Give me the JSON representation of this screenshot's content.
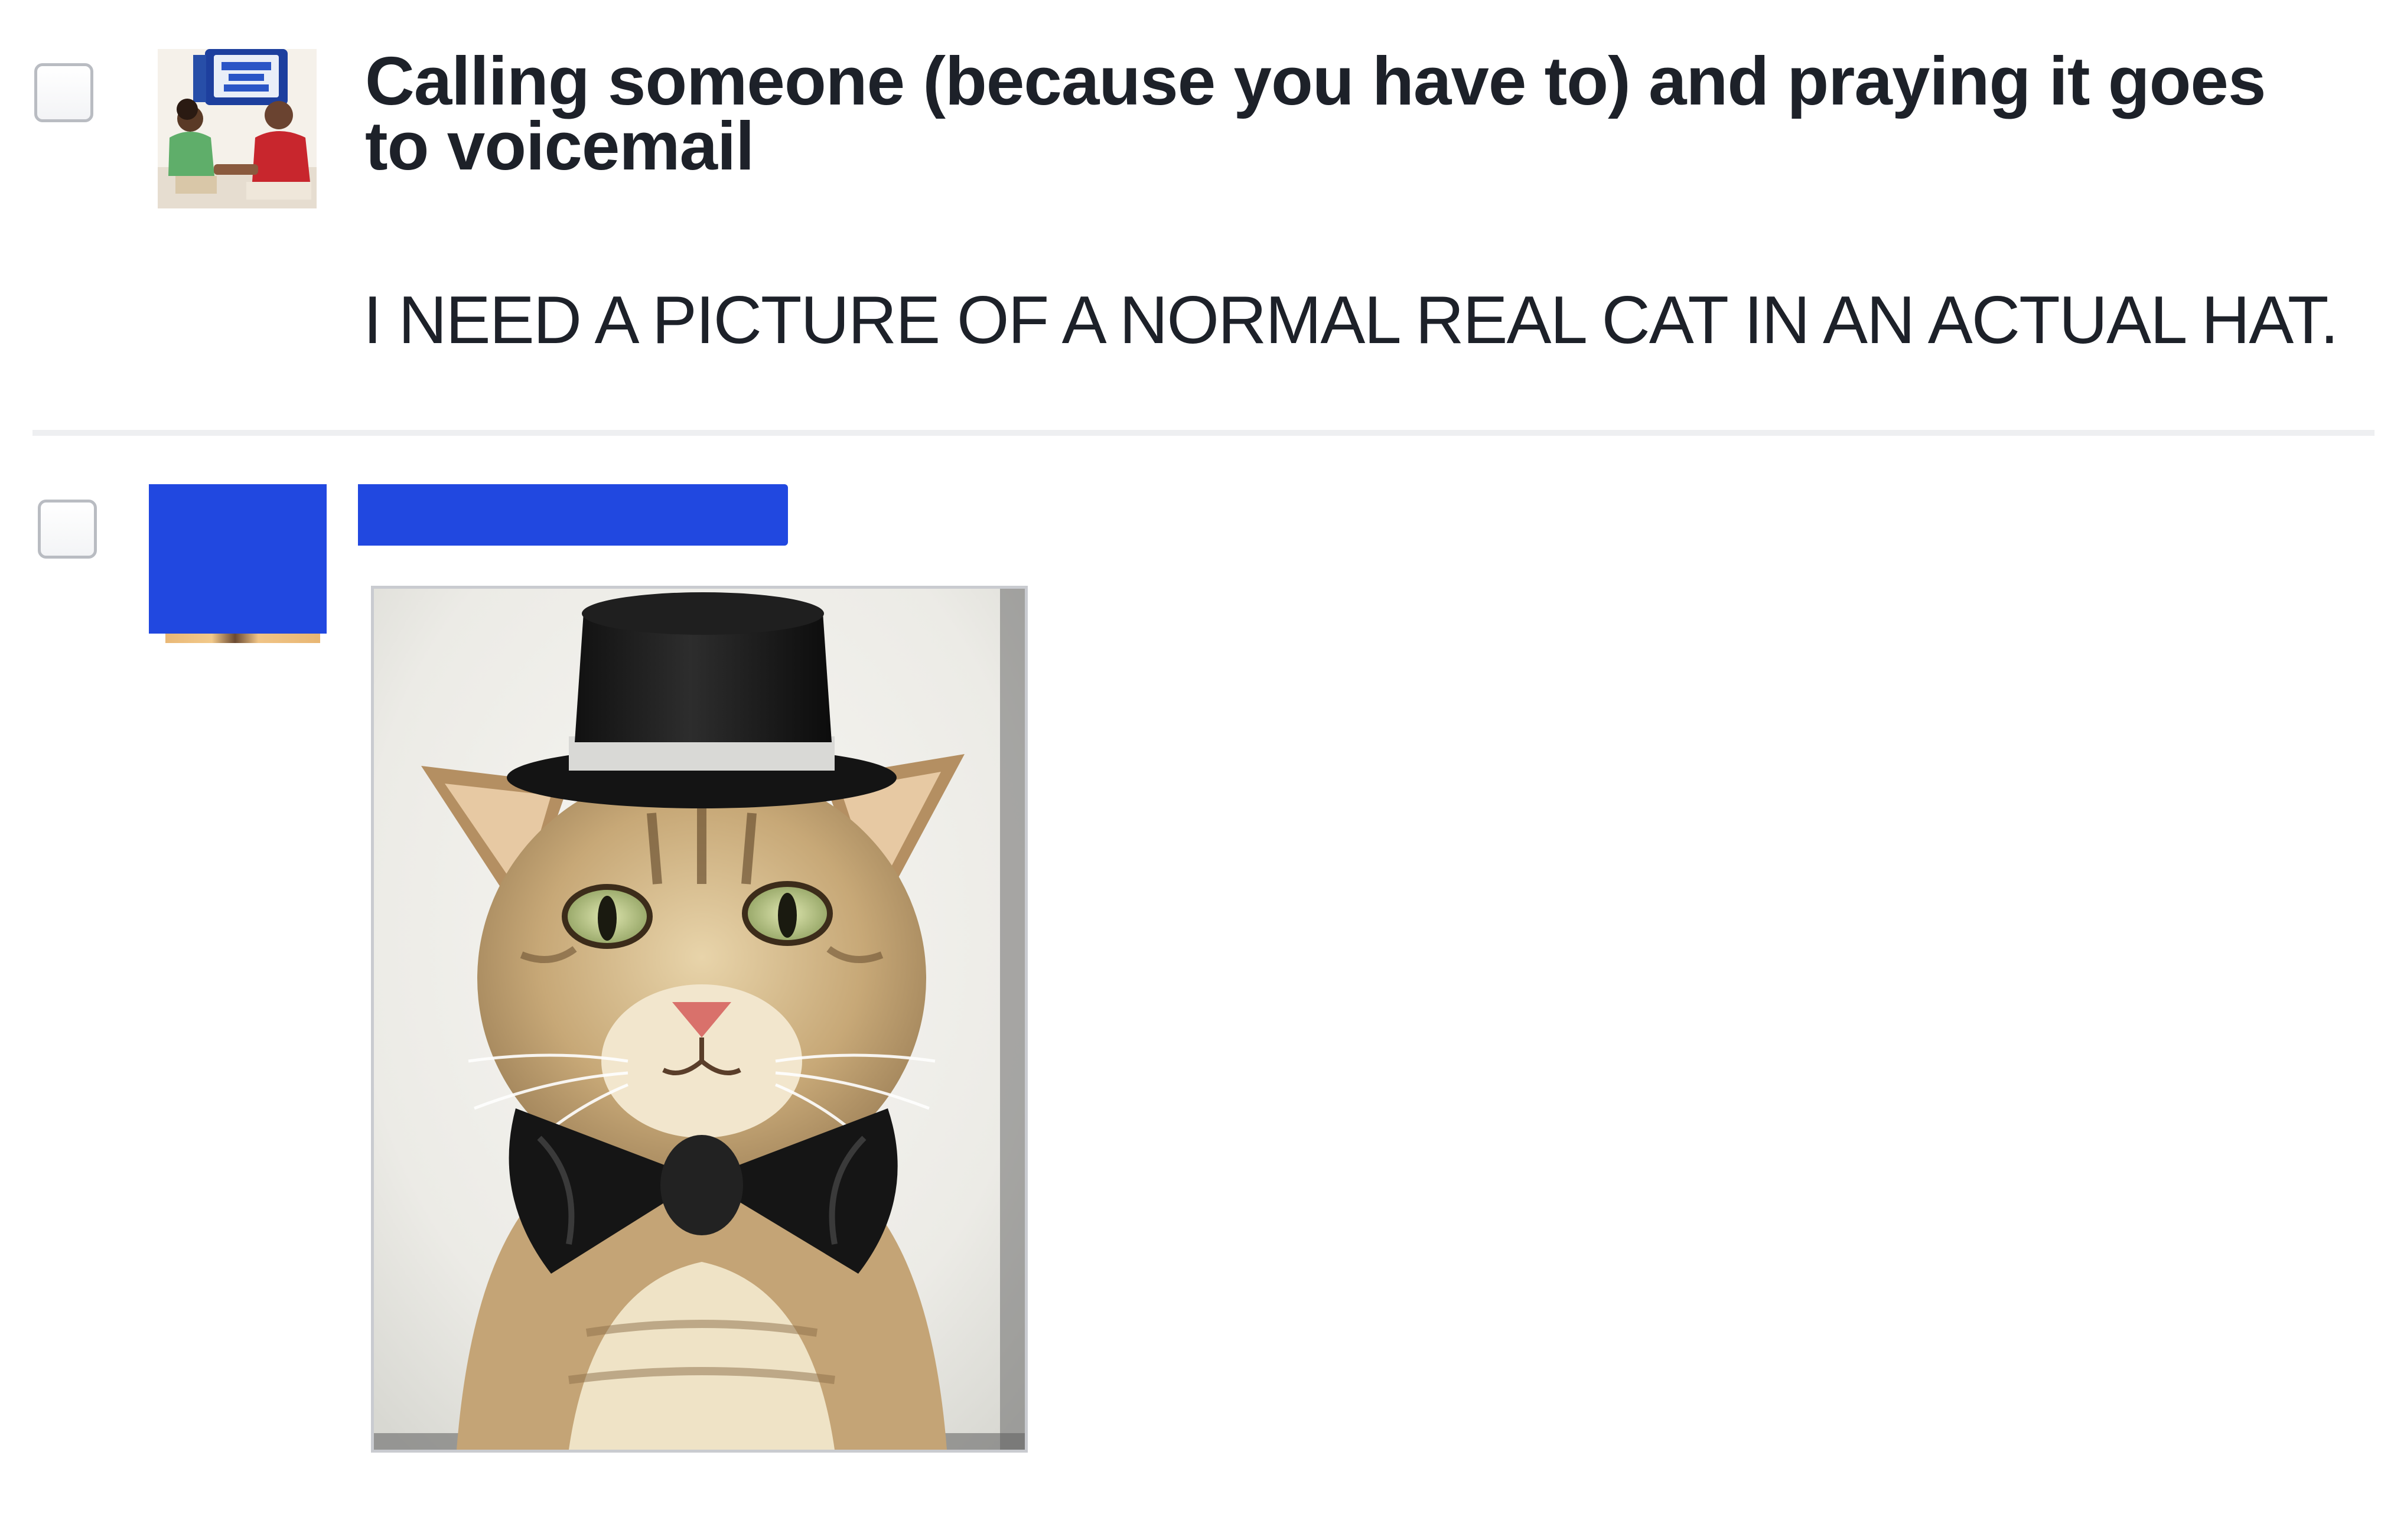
{
  "messages": [
    {
      "title": "Calling someone (because you have to) and praying it goes to voicemail",
      "body": "I NEED A PICTURE OF A NORMAL REAL CAT IN AN ACTUAL HAT."
    },
    {
      "attachment": "cat-in-top-hat-photo"
    }
  ],
  "colors": {
    "text": "#1d2129",
    "redaction": "#2148e0",
    "divider": "#eeeff1",
    "checkbox_border": "#b9bcc2"
  }
}
